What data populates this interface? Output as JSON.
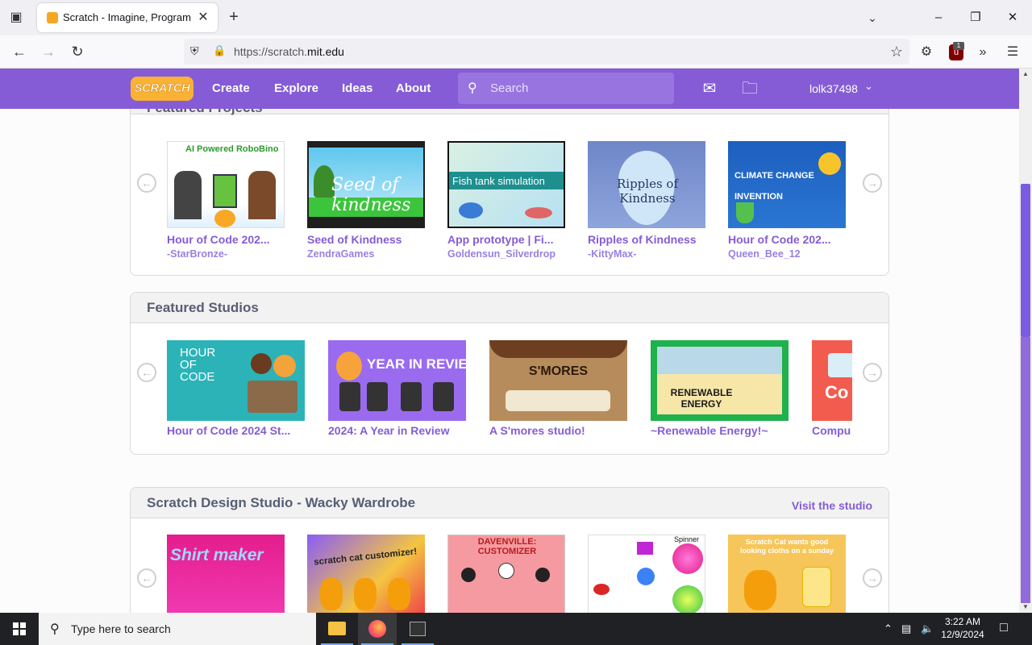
{
  "browser": {
    "tab_title": "Scratch - Imagine, Program, Share",
    "url_prefix": "https://scratch.",
    "url_domain": "mit.edu",
    "ext_badge": "1",
    "icons": [
      "tab-list-icon",
      "new-tab-icon",
      "back-icon",
      "forward-icon",
      "reload-icon",
      "shield-icon",
      "lock-icon",
      "star-icon",
      "extensions-icon",
      "ublock-icon",
      "overflow-icon",
      "menu-icon"
    ]
  },
  "scratch_nav": {
    "logo": "SCRATCH",
    "links": [
      "Create",
      "Explore",
      "Ideas",
      "About"
    ],
    "search_placeholder": "Search",
    "username": "lolk37498"
  },
  "featured_projects": {
    "title": "Featured Projects",
    "items": [
      {
        "title": "Hour of Code 202...",
        "author": "-StarBronze-",
        "thumb_text": "AI Powered RoboBino"
      },
      {
        "title": "Seed of Kindness",
        "author": "ZendraGames",
        "thumb_text": "Seed of kindness"
      },
      {
        "title": "App prototype | Fi...",
        "author": "Goldensun_Silverdrop",
        "thumb_text": "Fish tank simulation"
      },
      {
        "title": "Ripples of Kindness",
        "author": "-KittyMax-",
        "thumb_text": "Ripples of Kindness"
      },
      {
        "title": "Hour of Code 202...",
        "author": "Queen_Bee_12",
        "thumb_text": "CLIMATE CHANGE INVENTION"
      }
    ]
  },
  "featured_studios": {
    "title": "Featured Studios",
    "items": [
      {
        "title": "Hour of Code 2024 St...",
        "thumb_text": "HOUR OF CODE"
      },
      {
        "title": "2024: A Year in Review",
        "thumb_text": "YEAR IN REVIEW"
      },
      {
        "title": "A S'mores studio!",
        "thumb_text": "S'MORES"
      },
      {
        "title": "~Renewable Energy!~",
        "thumb_text": "RENEWABLE ENERGY"
      },
      {
        "title": "Compu",
        "thumb_text": "Co"
      }
    ]
  },
  "design_studio": {
    "title": "Scratch Design Studio - Wacky Wardrobe",
    "link": "Visit the studio",
    "items": [
      {
        "thumb_text": "Shirt maker"
      },
      {
        "thumb_text": "scratch cat customizer!"
      },
      {
        "thumb_text": "DAVENVILLE: CUSTOMIZER"
      },
      {
        "thumb_text": "Spinner"
      },
      {
        "thumb_text": "Scratch Cat wants good looking cloths on a sunday"
      }
    ]
  },
  "taskbar": {
    "search_text": "Type here to search",
    "time": "3:22 AM",
    "date": "12/9/2024"
  },
  "colors": {
    "scratch_purple": "#855cd6",
    "link_purple": "#855cd6",
    "header_text": "#575e75"
  }
}
